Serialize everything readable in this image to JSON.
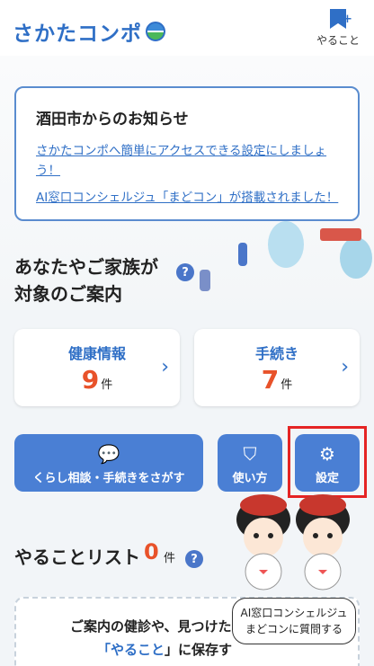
{
  "header": {
    "logo_text": "さかたコンポ",
    "todo_label": "やること"
  },
  "notice": {
    "title": "酒田市からのお知らせ",
    "links": [
      "さかたコンポへ簡単にアクセスできる設定にしましょう！",
      "AI窓口コンシェルジュ「まどコン」が搭載されました！"
    ]
  },
  "guide": {
    "title_line1": "あなたやご家族が",
    "title_line2": "対象のご案内",
    "help_icon": "?",
    "cards": [
      {
        "label": "健康情報",
        "count": "9",
        "unit": "件"
      },
      {
        "label": "手続き",
        "count": "7",
        "unit": "件"
      }
    ]
  },
  "actions": [
    {
      "label": "くらし相談・手続きをさがす",
      "icon": "chat-bubbles-icon"
    },
    {
      "label": "使い方",
      "icon": "beginner-mark-icon"
    },
    {
      "label": "設定",
      "icon": "gear-icon"
    }
  ],
  "todo": {
    "title": "やることリスト",
    "count": "0",
    "unit": "件",
    "empty_line1": "ご案内の健診や、見つけた",
    "empty_line2_prefix": "「",
    "empty_line2_keyword": "やること",
    "empty_line2_suffix": "」に保存す"
  },
  "concierge": {
    "line1": "AI窓口コンシェルジュ",
    "line2": "まどコンに質問する"
  },
  "colors": {
    "brand_blue": "#2f6fc6",
    "button_blue": "#4a7fd4",
    "count_orange": "#e8522a",
    "highlight_red": "#e52424"
  }
}
